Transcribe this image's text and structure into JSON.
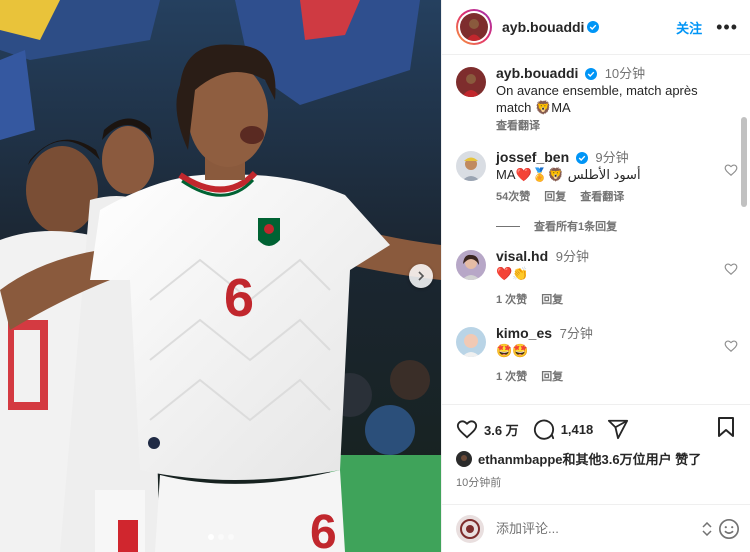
{
  "post": {
    "author": "ayb.bouaddi",
    "follow_label": "关注",
    "more_label": "•••"
  },
  "photo": {
    "jersey_number": "6",
    "next_label": "›"
  },
  "caption": {
    "author": "ayb.bouaddi",
    "time": "10分钟",
    "text": "On avance ensemble, match après match 🦁MA",
    "translate_label": "查看翻译"
  },
  "comments": [
    {
      "author": "jossef_ben",
      "time": "9分钟",
      "text_prefix": "MA❤️🏅🦁",
      "text_arabic": "أسود الأطلس",
      "likes": "54次赞",
      "reply_label": "回复",
      "translate_label": "查看翻译",
      "view_replies_label": "查看所有1条回复"
    },
    {
      "author": "visal.hd",
      "time": "9分钟",
      "text": "❤️👏",
      "likes": "1 次赞",
      "reply_label": "回复"
    },
    {
      "author": "kimo_es",
      "time": "7分钟",
      "text": "🤩🤩",
      "likes": "1 次赞",
      "reply_label": "回复"
    }
  ],
  "actions": {
    "likes_count": "3.6 万",
    "comments_count": "1,418",
    "liked_by_text": "ethanmbappe和其他3.6万位用户 赞了",
    "time_ago": "10分钟前"
  },
  "add_comment": {
    "placeholder": "添加评论..."
  },
  "colors": {
    "accent": "#0095f6",
    "verified": "#0095f6",
    "heart_red": "#ed4956",
    "jersey_red": "#c1272d",
    "morocco_green": "#006233"
  },
  "icons": [
    "verified-icon",
    "heart-icon",
    "comment-icon",
    "share-icon",
    "bookmark-icon",
    "emoji-icon",
    "chevron-right-icon"
  ]
}
